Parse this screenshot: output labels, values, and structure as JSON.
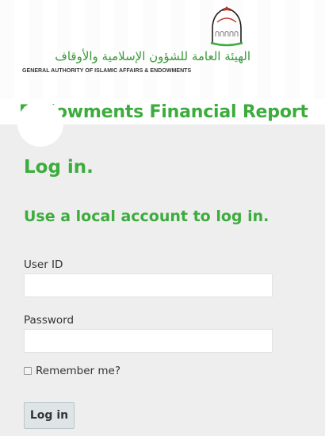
{
  "header": {
    "arabic_name": "الهيئة العامة للشؤون الإسلامية والأوقاف",
    "english_name": "GENERAL AUTHORITY OF ISLAMIC AFFAIRS & ENDOWMENTS",
    "logo_icon": "mosque-dome-icon",
    "site_title": "Endowments Financial Report"
  },
  "login": {
    "title": "Log in.",
    "subtitle": "Use a local account to log in.",
    "user_id_label": "User ID",
    "user_id_value": "",
    "user_id_placeholder": "",
    "password_label": "Password",
    "password_value": "",
    "password_placeholder": "",
    "remember_label": "Remember me?",
    "remember_checked": false,
    "submit_label": "Log in"
  },
  "colors": {
    "brand_green": "#3cac3c",
    "dome_red": "#c0392b",
    "panel_bg": "#eeeeee",
    "button_bg": "#dfe5e6"
  }
}
